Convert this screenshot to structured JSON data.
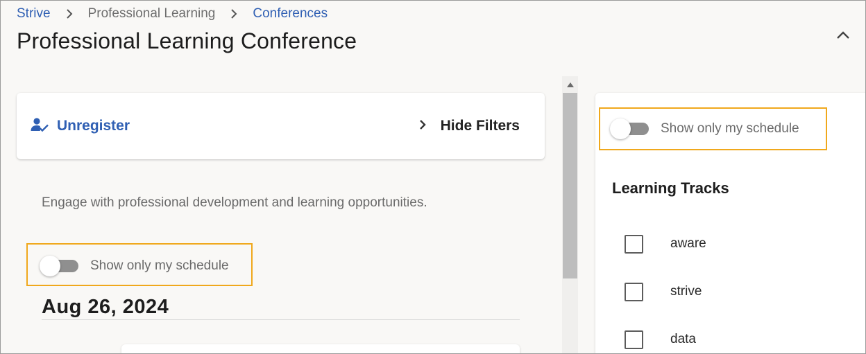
{
  "breadcrumb": {
    "items": [
      {
        "label": "Strive",
        "link": true
      },
      {
        "label": "Professional Learning",
        "link": false
      },
      {
        "label": "Conferences",
        "link": true
      }
    ]
  },
  "page": {
    "title": "Professional Learning Conference"
  },
  "actions": {
    "unregister_label": "Unregister",
    "hide_filters_label": "Hide Filters"
  },
  "main": {
    "description": "Engage with professional development and learning opportunities.",
    "schedule_toggle_label": "Show only my schedule",
    "schedule_toggle_on": false,
    "date_heading": "Aug 26, 2024"
  },
  "filters": {
    "schedule_toggle_label": "Show only my schedule",
    "schedule_toggle_on": false,
    "tracks_heading": "Learning Tracks",
    "tracks": [
      {
        "label": "aware",
        "checked": false
      },
      {
        "label": "strive",
        "checked": false
      },
      {
        "label": "data",
        "checked": false
      }
    ]
  },
  "colors": {
    "link": "#2f5fb3",
    "highlight": "#f0a81c",
    "background": "#f9f8f6"
  },
  "icons": {
    "breadcrumb_separator": "chevron-right-icon",
    "collapse": "chevron-up-icon",
    "unregister": "user-check-icon",
    "hide_filters": "chevron-right-icon"
  }
}
